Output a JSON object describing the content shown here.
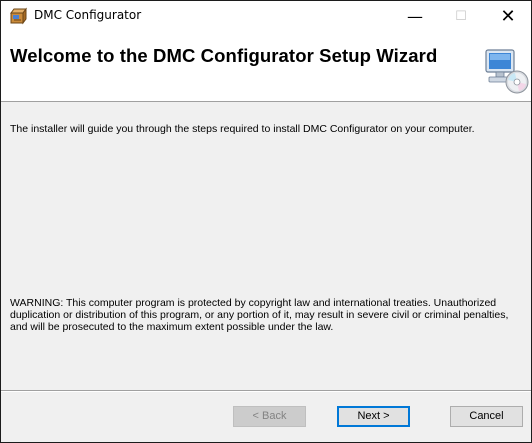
{
  "window": {
    "title": "DMC Configurator",
    "icon": "installer-box-icon",
    "minimize_glyph": "—",
    "maximize_glyph": "☐",
    "close_glyph": "✕"
  },
  "banner": {
    "title": "Welcome to the DMC Configurator Setup Wizard",
    "image": "computer-with-disc-icon"
  },
  "body": {
    "intro": "The installer will guide you through the steps required to install DMC Configurator on your computer.",
    "warning": "WARNING: This computer program is protected by copyright law and international treaties. Unauthorized duplication or distribution of this program, or any portion of it, may result in severe civil or criminal penalties, and will be prosecuted to the maximum extent possible under the law."
  },
  "buttons": {
    "back": "< Back",
    "next": "Next >",
    "cancel": "Cancel"
  },
  "colors": {
    "focus_border": "#0078d7",
    "dialog_background": "#f0f0f0",
    "banner_background": "#ffffff"
  }
}
